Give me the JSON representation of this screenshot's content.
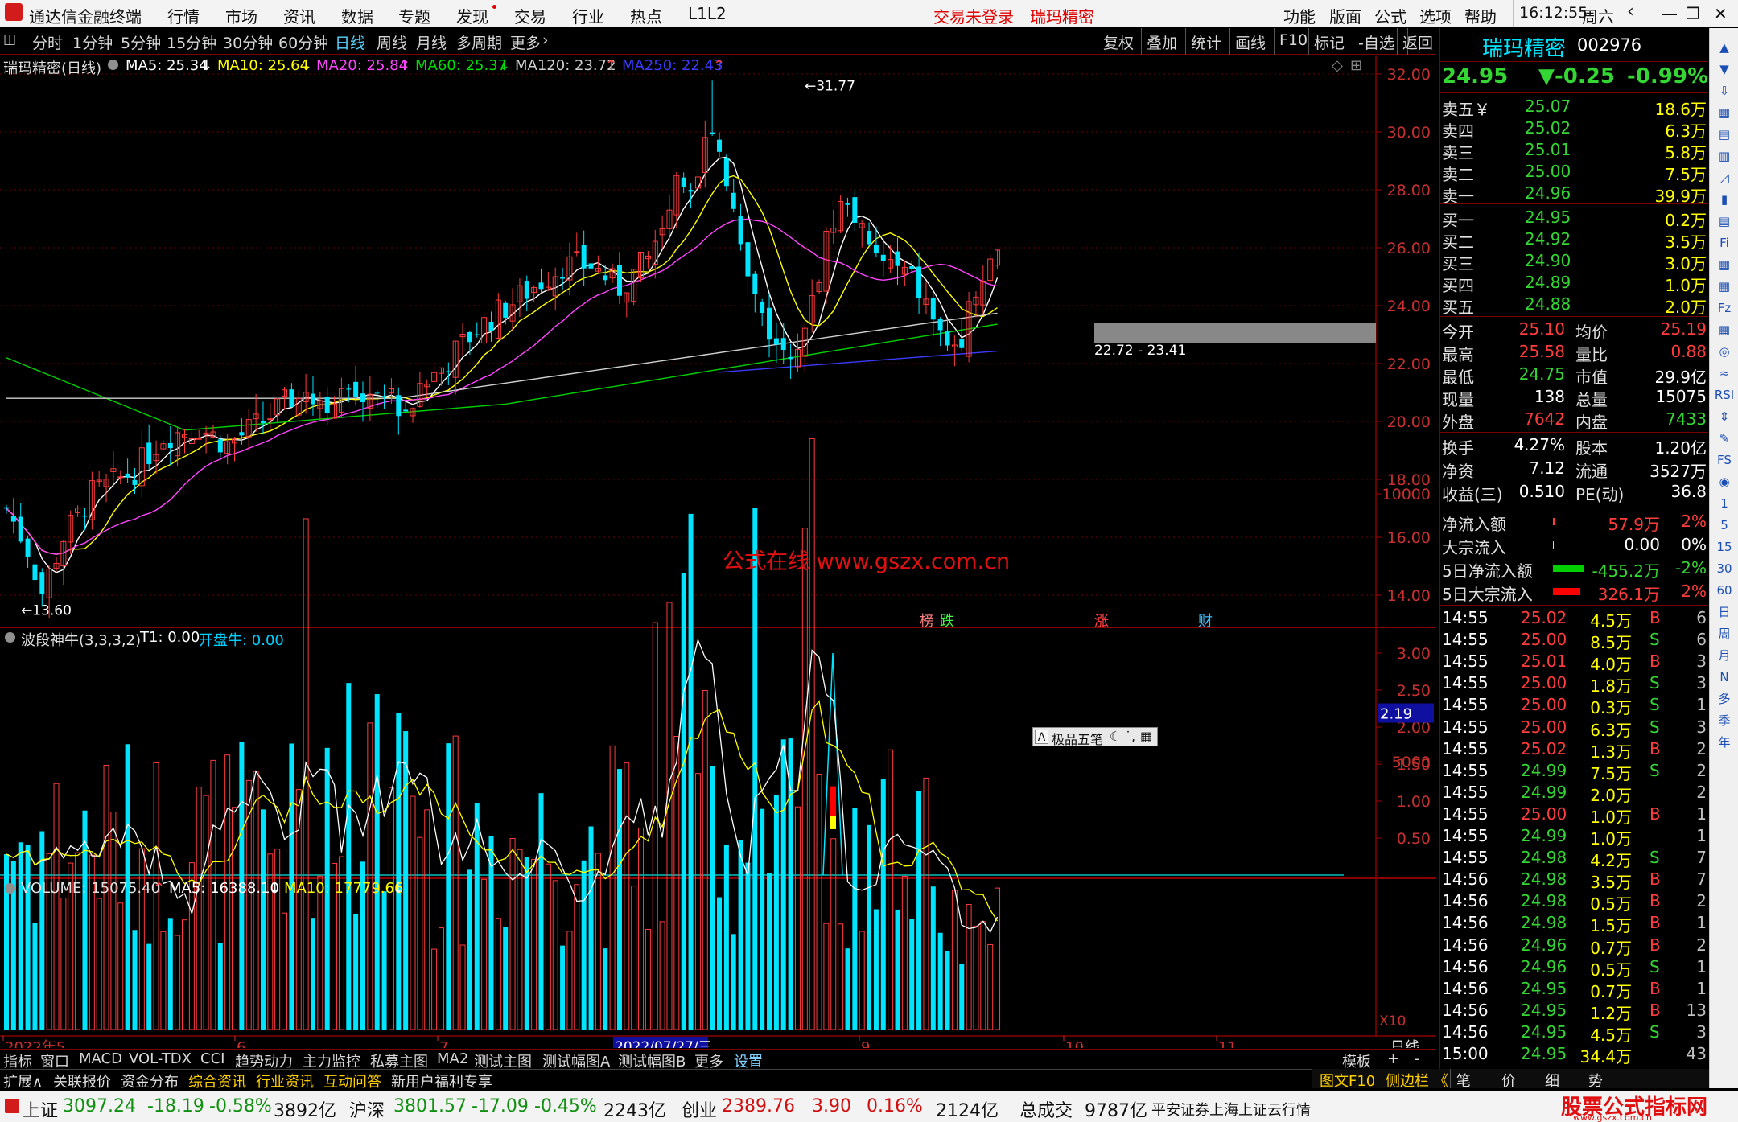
{
  "window": {
    "app_name": "通达信金融终端",
    "menus": [
      "行情",
      "市场",
      "资讯",
      "数据",
      "专题",
      "发现",
      "交易",
      "行业",
      "热点",
      "L1L2"
    ],
    "trade_status": "交易未登录",
    "stock_name_top": "瑞玛精密",
    "right_menus": [
      "功能",
      "版面",
      "公式",
      "选项",
      "帮助"
    ],
    "time": "16:12:55",
    "weekday": "周六"
  },
  "period_bar": {
    "periods": [
      "分时",
      "1分钟",
      "5分钟",
      "15分钟",
      "30分钟",
      "60分钟",
      "日线",
      "周线",
      "月线",
      "多周期",
      "更多"
    ],
    "active": "日线",
    "right_buttons": [
      "复权",
      "叠加",
      "统计",
      "画线",
      "F10",
      "标记",
      "-自选",
      "返回"
    ]
  },
  "main_chart": {
    "title": "瑞玛精密(日线)",
    "ma_labels": [
      {
        "text": "MA5: 25.34",
        "color": "#ffffff",
        "arrow": "↓"
      },
      {
        "text": "MA10: 25.64",
        "color": "#ffff00",
        "arrow": "↓"
      },
      {
        "text": "MA20: 25.84",
        "color": "#ff44ff",
        "arrow": "↑"
      },
      {
        "text": "MA60: 25.37",
        "color": "#00e000",
        "arrow": "↓"
      },
      {
        "text": "MA120: 23.72",
        "color": "#d0d0d0",
        "arrow": "↑"
      },
      {
        "text": "MA250: 22.43",
        "color": "#3b3bff",
        "arrow": "↑"
      }
    ],
    "y_ticks": [
      "32.00",
      "30.00",
      "28.00",
      "26.00",
      "24.00",
      "22.00",
      "20.00",
      "18.00",
      "16.00",
      "14.00"
    ],
    "high_label": "31.77",
    "low_label": "13.60",
    "range_label": "22.72 - 23.41",
    "watermark": "公式在线  www.gszx.com.cn",
    "event_tags": [
      {
        "text": "榜",
        "color": "#ff8080"
      },
      {
        "text": "跌",
        "color": "#40ff40"
      },
      {
        "text": "涨",
        "color": "#ff4040"
      },
      {
        "text": "财",
        "color": "#40c0ff"
      }
    ]
  },
  "indicator_chart": {
    "title": "波段神牛(3,3,3,2)",
    "t1": "T1: 0.00",
    "kpn": "开盘牛: 0.00",
    "y_ticks": [
      "3.00",
      "2.50",
      "2.00",
      "1.50",
      "1.00",
      "0.50"
    ],
    "current": "2.19",
    "ime_label": "极品五笔"
  },
  "volume_chart": {
    "title": "VOLUME: 15075.40",
    "ma5": "MA5: 16388.10",
    "ma10": "MA10: 17779.66",
    "y_ticks": [
      "10000",
      "5000"
    ],
    "unit": "X10"
  },
  "x_axis": {
    "labels": [
      "2022年5",
      "6",
      "7",
      "2022/07/27/三",
      "9",
      "10",
      "11"
    ],
    "period": "日线"
  },
  "tabs_row1": [
    "指标",
    "窗口",
    "MACD",
    "VOL-TDX",
    "CCI",
    "趋势动力",
    "主力监控",
    "私募主图",
    "MA2",
    "测试主图",
    "测试幅图A",
    "测试幅图B",
    "更多",
    "设置"
  ],
  "tabs_row1_right": [
    "模板",
    "+",
    "-"
  ],
  "tabs_row2": [
    {
      "text": "扩展∧",
      "color": "#e0e0e0"
    },
    {
      "text": "关联报价",
      "color": "#e0e0e0"
    },
    {
      "text": "资金分布",
      "color": "#e0e0e0"
    },
    {
      "text": "综合资讯",
      "color": "#ffd000"
    },
    {
      "text": "行业资讯",
      "color": "#ffd000"
    },
    {
      "text": "互动问答",
      "color": "#ffd000"
    },
    {
      "text": "新用户福利专享",
      "color": "#e0e0e0"
    }
  ],
  "panel_bottom": [
    "图文F10",
    "侧边栏 《",
    "笔",
    "价",
    "细",
    "势"
  ],
  "quote_panel": {
    "name": "瑞玛精密",
    "code": "002976",
    "price": "24.95",
    "change": "▼-0.25",
    "pct": "-0.99%",
    "asks": [
      {
        "label": "卖五￥",
        "price": "25.07",
        "vol": "18.6万"
      },
      {
        "label": "卖四",
        "price": "25.02",
        "vol": "6.3万"
      },
      {
        "label": "卖三",
        "price": "25.01",
        "vol": "5.8万"
      },
      {
        "label": "卖二",
        "price": "25.00",
        "vol": "7.5万"
      },
      {
        "label": "卖一",
        "price": "24.96",
        "vol": "39.9万"
      }
    ],
    "bids": [
      {
        "label": "买一",
        "price": "24.95",
        "vol": "0.2万"
      },
      {
        "label": "买二",
        "price": "24.92",
        "vol": "3.5万"
      },
      {
        "label": "买三",
        "price": "24.90",
        "vol": "3.0万"
      },
      {
        "label": "买四",
        "price": "24.89",
        "vol": "1.0万"
      },
      {
        "label": "买五",
        "price": "24.88",
        "vol": "2.0万"
      }
    ],
    "stats1": [
      {
        "l1": "今开",
        "v1": "25.10",
        "c1": "#ff3c3c",
        "l2": "均价",
        "v2": "25.19",
        "c2": "#ff3c3c"
      },
      {
        "l1": "最高",
        "v1": "25.58",
        "c1": "#ff3c3c",
        "l2": "量比",
        "v2": "0.88",
        "c2": "#ff3c3c"
      },
      {
        "l1": "最低",
        "v1": "24.75",
        "c1": "#34d634",
        "l2": "市值",
        "v2": "29.9亿",
        "c2": "#ffffff"
      },
      {
        "l1": "现量",
        "v1": "138",
        "c1": "#ffffff",
        "l2": "总量",
        "v2": "15075",
        "c2": "#ffffff"
      },
      {
        "l1": "外盘",
        "v1": "7642",
        "c1": "#ff3c3c",
        "l2": "内盘",
        "v2": "7433",
        "c2": "#34d634"
      }
    ],
    "stats2": [
      {
        "l1": "换手",
        "v1": "4.27%",
        "l2": "股本",
        "v2": "1.20亿"
      },
      {
        "l1": "净资",
        "v1": "7.12",
        "l2": "流通",
        "v2": "3527万"
      },
      {
        "l1": "收益(三)",
        "v1": "0.510",
        "l2": "PE(动)",
        "v2": "36.8"
      }
    ],
    "flows": [
      {
        "label": "净流入额",
        "value": "57.9万",
        "pct": "2%",
        "color": "#ff3c3c",
        "bar": 0.05,
        "barColor": "#ff3c3c"
      },
      {
        "label": "大宗流入",
        "value": "0.00",
        "pct": "0%",
        "color": "#ffffff",
        "bar": 0.02,
        "barColor": "#cccccc"
      },
      {
        "label": "5日净流入额",
        "value": "-455.2万",
        "pct": "-2%",
        "color": "#34d634",
        "bar": 0.9,
        "barColor": "#00d000"
      },
      {
        "label": "5日大宗流入",
        "value": "326.1万",
        "pct": "2%",
        "color": "#ff3c3c",
        "bar": 0.8,
        "barColor": "#ff0000"
      }
    ],
    "ticks": [
      {
        "t": "14:55",
        "p": "25.02",
        "pc": "#ff3c3c",
        "v": "4.5万",
        "s": "B",
        "n": "6"
      },
      {
        "t": "14:55",
        "p": "25.00",
        "pc": "#ff3c3c",
        "v": "8.5万",
        "s": "S",
        "n": "6"
      },
      {
        "t": "14:55",
        "p": "25.01",
        "pc": "#ff3c3c",
        "v": "4.0万",
        "s": "B",
        "n": "3"
      },
      {
        "t": "14:55",
        "p": "25.00",
        "pc": "#ff3c3c",
        "v": "1.8万",
        "s": "S",
        "n": "3"
      },
      {
        "t": "14:55",
        "p": "25.00",
        "pc": "#ff3c3c",
        "v": "0.3万",
        "s": "S",
        "n": "1"
      },
      {
        "t": "14:55",
        "p": "25.00",
        "pc": "#ff3c3c",
        "v": "6.3万",
        "s": "S",
        "n": "3"
      },
      {
        "t": "14:55",
        "p": "25.02",
        "pc": "#ff3c3c",
        "v": "1.3万",
        "s": "B",
        "n": "2"
      },
      {
        "t": "14:55",
        "p": "24.99",
        "pc": "#34d634",
        "v": "7.5万",
        "s": "S",
        "n": "2"
      },
      {
        "t": "14:55",
        "p": "24.99",
        "pc": "#34d634",
        "v": "2.0万",
        "s": "",
        "n": "2"
      },
      {
        "t": "14:55",
        "p": "25.00",
        "pc": "#ff3c3c",
        "v": "1.0万",
        "s": "B",
        "n": "1"
      },
      {
        "t": "14:55",
        "p": "24.99",
        "pc": "#34d634",
        "v": "1.0万",
        "s": "",
        "n": "1"
      },
      {
        "t": "14:55",
        "p": "24.98",
        "pc": "#34d634",
        "v": "4.2万",
        "s": "S",
        "n": "7"
      },
      {
        "t": "14:56",
        "p": "24.98",
        "pc": "#34d634",
        "v": "3.5万",
        "s": "B",
        "n": "7"
      },
      {
        "t": "14:56",
        "p": "24.98",
        "pc": "#34d634",
        "v": "0.5万",
        "s": "B",
        "n": "2"
      },
      {
        "t": "14:56",
        "p": "24.98",
        "pc": "#34d634",
        "v": "1.5万",
        "s": "B",
        "n": "1"
      },
      {
        "t": "14:56",
        "p": "24.96",
        "pc": "#34d634",
        "v": "0.7万",
        "s": "B",
        "n": "2"
      },
      {
        "t": "14:56",
        "p": "24.96",
        "pc": "#34d634",
        "v": "0.5万",
        "s": "S",
        "n": "1"
      },
      {
        "t": "14:56",
        "p": "24.95",
        "pc": "#34d634",
        "v": "0.7万",
        "s": "B",
        "n": "1"
      },
      {
        "t": "14:56",
        "p": "24.95",
        "pc": "#34d634",
        "v": "1.2万",
        "s": "B",
        "n": "13"
      },
      {
        "t": "14:56",
        "p": "24.95",
        "pc": "#34d634",
        "v": "4.5万",
        "s": "S",
        "n": "3"
      },
      {
        "t": "15:00",
        "p": "24.95",
        "pc": "#34d634",
        "v": "34.4万",
        "s": "",
        "n": "43"
      }
    ]
  },
  "right_toolbar": [
    "▲",
    "▼",
    "⇩",
    "▦",
    "▤",
    "▥",
    "◿",
    "▮",
    "▤",
    "Fi",
    "▦",
    "▦",
    "Fz",
    "▦",
    "◎",
    "≈",
    "RSI",
    "⇕",
    "✎",
    "FS",
    "◉",
    "1",
    "5",
    "15",
    "30",
    "60",
    "日",
    "周",
    "月",
    "N",
    "多",
    "季",
    "年"
  ],
  "status_bar": [
    {
      "name": "上证",
      "val": "3097.24",
      "chg": "-18.19",
      "pct": "-0.58%",
      "amt": "3892亿"
    },
    {
      "name": "沪深",
      "val": "3801.57",
      "chg": "-17.09",
      "pct": "-0.45%",
      "amt": "2243亿"
    },
    {
      "name": "创业",
      "val": "2389.76",
      "chg": "3.90",
      "pct": "0.16%",
      "amt": "2124亿"
    }
  ],
  "status_total_label": "总成交",
  "status_total": "9787亿",
  "status_broker": "平安证券上海上证云行情",
  "status_logo": "股票公式指标网",
  "status_logo_url": "www.gszx.com.cn"
}
